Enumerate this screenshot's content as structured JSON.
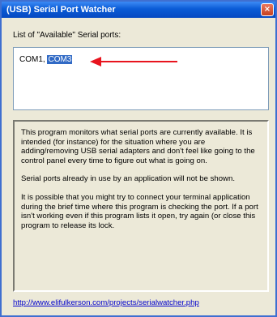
{
  "window": {
    "title": "(USB) Serial Port Watcher",
    "close_glyph": "×"
  },
  "ports": {
    "label": "List of \"Available\" Serial ports:",
    "items": [
      "COM1",
      "COM3"
    ],
    "separator": ", ",
    "selected_index": 1,
    "annotation_arrow_color": "#e8141e"
  },
  "description": {
    "paragraphs": [
      "This program monitors what serial ports are currently available.  It is intended (for instance) for the situation where you are adding/removing USB serial adapters and don't feel like going to the control panel every time to figure out what is going on.",
      "Serial ports already in use by an application will not be shown.",
      "It is possible that you might try to connect your terminal application during the brief time where this program is checking the port.  If a port isn't working even if this program lists it open, try again (or close this program to release its lock."
    ]
  },
  "footer": {
    "url": "http://www.elifulkerson.com/projects/serialwatcher.php"
  },
  "colors": {
    "titlebar": "#0a5bd6",
    "window_bg": "#ece9d8",
    "selection": "#316ac5",
    "link": "#0000cc"
  }
}
